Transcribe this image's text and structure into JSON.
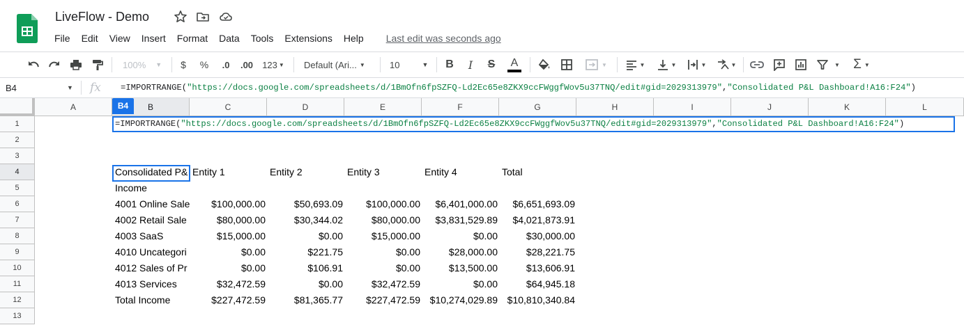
{
  "app": {
    "doc_title": "LiveFlow - Demo",
    "menu": [
      "File",
      "Edit",
      "View",
      "Insert",
      "Format",
      "Data",
      "Tools",
      "Extensions",
      "Help"
    ],
    "last_edit": "Last edit was seconds ago"
  },
  "toolbar": {
    "zoom": "100%",
    "currency": "$",
    "percent": "%",
    "dec_decrease": ".0",
    "dec_increase": ".00",
    "number_format": "123",
    "font_family": "Default (Ari...",
    "font_size": "10"
  },
  "formula_bar": {
    "name_box": "B4",
    "fx": "fx",
    "formula_prefix": "=IMPORTRANGE(",
    "formula_url": "\"https://docs.google.com/spreadsheets/d/1BmOfn6fpSZFQ-Ld2Ec65e8ZKX9ccFWggfWov5u37TNQ/edit#gid=2029313979\"",
    "formula_comma": ",",
    "formula_range": "\"Consolidated P&L Dashboard!A16:F24\"",
    "formula_suffix": ")"
  },
  "grid": {
    "columns": [
      "A",
      "B",
      "C",
      "D",
      "E",
      "F",
      "G",
      "H",
      "I",
      "J",
      "K",
      "L"
    ],
    "rows": [
      "1",
      "2",
      "3",
      "4",
      "5",
      "6",
      "7",
      "8",
      "9",
      "10",
      "11",
      "12",
      "13"
    ],
    "active_cell_tag": "B4",
    "b1_formula_prefix": "=IMPORTRANGE(",
    "b1_formula_url": "\"https://docs.google.com/spreadsheets/d/1BmOfn6fpSZFQ-Ld2Ec65e8ZKX9ccFWggfWov5u37TNQ/edit#gid=2029313979\"",
    "b1_formula_comma": ",",
    "b1_formula_range": "\"Consolidated P&L Dashboard!A16:F24\"",
    "b1_formula_suffix": ")",
    "table": [
      [
        "Consolidated P&",
        "Entity 1",
        "Entity 2",
        "Entity 3",
        "Entity 4",
        "Total"
      ],
      [
        "Income",
        "",
        "",
        "",
        "",
        ""
      ],
      [
        "4001 Online Sale",
        "$100,000.00",
        "$50,693.09",
        "$100,000.00",
        "$6,401,000.00",
        "$6,651,693.09"
      ],
      [
        "4002 Retail Sale",
        "$80,000.00",
        "$30,344.02",
        "$80,000.00",
        "$3,831,529.89",
        "$4,021,873.91"
      ],
      [
        "4003 SaaS",
        "$15,000.00",
        "$0.00",
        "$15,000.00",
        "$0.00",
        "$30,000.00"
      ],
      [
        "4010 Uncategori",
        "$0.00",
        "$221.75",
        "$0.00",
        "$28,000.00",
        "$28,221.75"
      ],
      [
        "4012 Sales of Pr",
        "$0.00",
        "$106.91",
        "$0.00",
        "$13,500.00",
        "$13,606.91"
      ],
      [
        "4013 Services",
        "$32,472.59",
        "$0.00",
        "$32,472.59",
        "$0.00",
        "$64,945.18"
      ],
      [
        "Total Income",
        "$227,472.59",
        "$81,365.77",
        "$227,472.59",
        "$10,274,029.89",
        "$10,810,340.84"
      ]
    ]
  },
  "colors": {
    "accent": "#1a73e8",
    "sheets_green": "#0f9d58",
    "string_green": "#0b8043"
  }
}
